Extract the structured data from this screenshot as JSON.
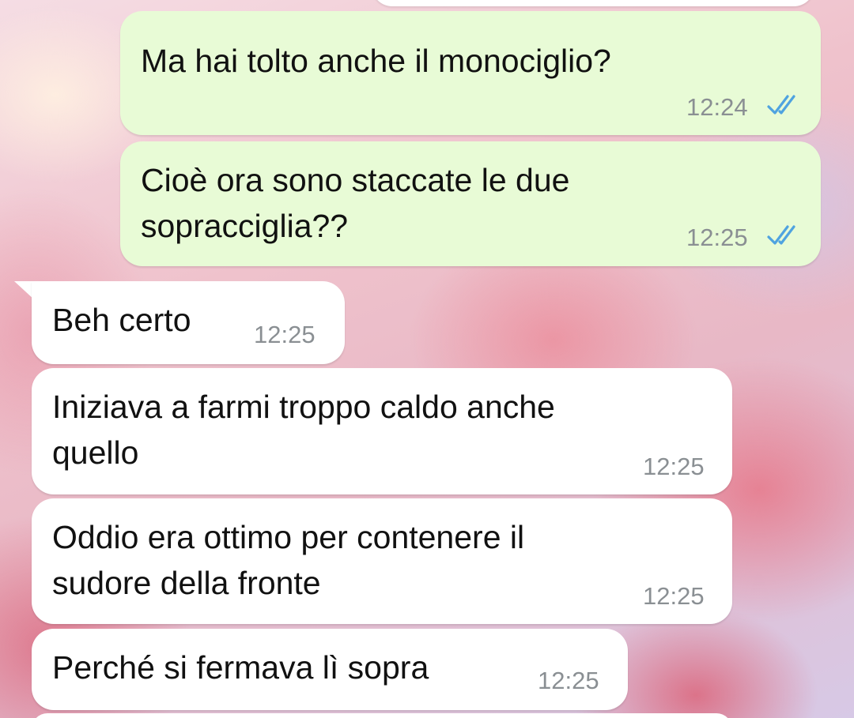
{
  "colors": {
    "outgoing_bubble": "#e8fbd6",
    "incoming_bubble": "#ffffff",
    "timestamp": "#8a8f93",
    "read_ticks": "#4fa3e0"
  },
  "messages": [
    {
      "direction": "outgoing",
      "text": "Ma hai tolto anche il monociglio?",
      "time": "12:24",
      "status_icon": "double-check-read-icon"
    },
    {
      "direction": "outgoing",
      "text_lines": [
        "Cioè ora sono staccate le due",
        "sopracciglia??"
      ],
      "time": "12:25",
      "status_icon": "double-check-read-icon"
    },
    {
      "direction": "incoming",
      "text": "Beh certo",
      "time": "12:25"
    },
    {
      "direction": "incoming",
      "text_lines": [
        "Iniziava a farmi troppo caldo anche",
        "quello"
      ],
      "time": "12:25"
    },
    {
      "direction": "incoming",
      "text_lines": [
        "Oddio era ottimo per contenere il",
        "sudore della fronte"
      ],
      "time": "12:25"
    },
    {
      "direction": "incoming",
      "text": "Perché si fermava lì sopra",
      "time": "12:25"
    }
  ]
}
